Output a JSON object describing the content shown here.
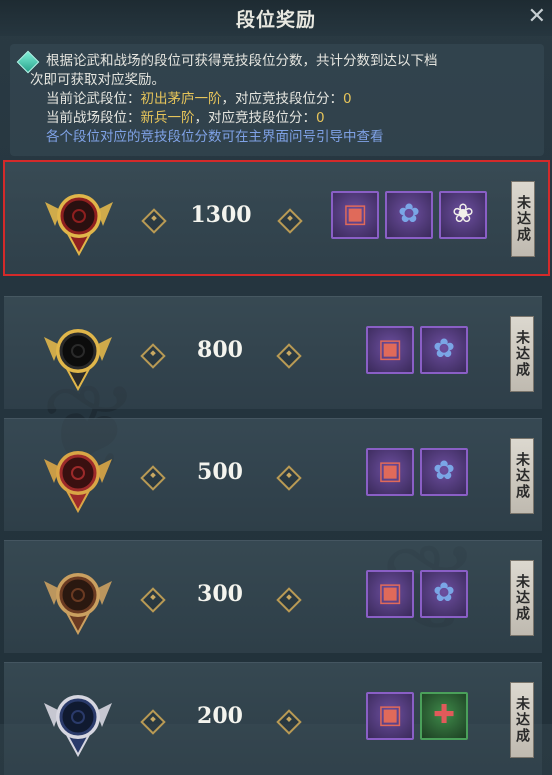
{
  "window": {
    "title": "段位奖励",
    "close": "✕"
  },
  "info": {
    "line1": "根据论武和战场的段位可获得竞技段位分数，共计分数到达以下档",
    "line2": "次即可获取对应奖励。",
    "line3_prefix": "当前论武段位：",
    "line3_rank": "初出茅庐一阶",
    "line3_mid": "，对应竞技段位分：",
    "line3_score": "0",
    "line4_prefix": "当前战场段位：",
    "line4_rank": "新兵一阶",
    "line4_mid": "，对应竞技段位分：",
    "line4_score": "0",
    "line5_link": "各个段位对应的竞技段位分数可在主界面问号引导中查看"
  },
  "tiers": [
    {
      "score": "1300",
      "status": "未达成",
      "badge": "gold-red-crown-badge",
      "items": [
        "chest",
        "pouch",
        "panda"
      ],
      "selected": true
    },
    {
      "score": "800",
      "status": "未达成",
      "badge": "gold-black-badge",
      "items": [
        "chest",
        "pouch"
      ]
    },
    {
      "score": "500",
      "status": "未达成",
      "badge": "red-gold-badge",
      "items": [
        "chest",
        "pouch"
      ]
    },
    {
      "score": "300",
      "status": "未达成",
      "badge": "bronze-badge",
      "items": [
        "chest",
        "pouch"
      ]
    },
    {
      "score": "200",
      "status": "未达成",
      "badge": "silver-blue-badge",
      "items": [
        "chest",
        "gift"
      ]
    }
  ],
  "colors": {
    "selection_border": "#d42a2a",
    "highlight_text": "#e6c45a",
    "link_text": "#7fa2e6"
  }
}
